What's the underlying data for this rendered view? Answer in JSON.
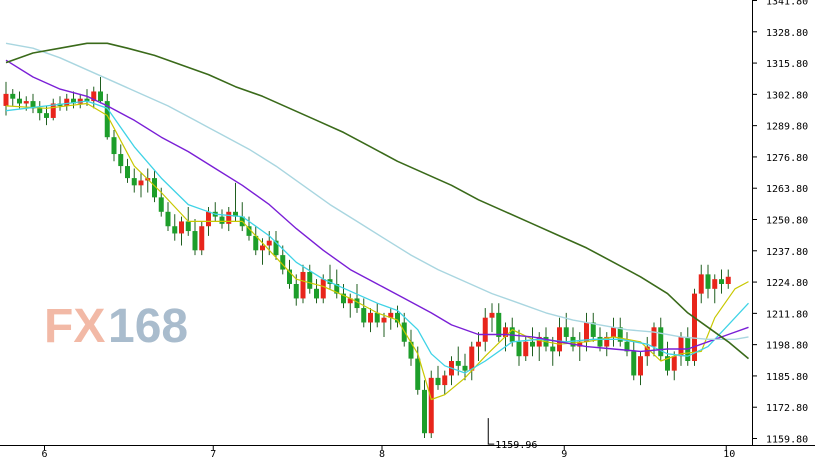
{
  "watermark": {
    "text_fx": "FX",
    "text_num": "168",
    "color_fx": "#f2b9a6",
    "color_num": "#a9bccd"
  },
  "colors": {
    "up": "#e8251b",
    "down": "#1d9e2a",
    "wick": "#1f5e1f",
    "ma_yellow": "#c8c800",
    "ma_cyan": "#3fd3e6",
    "ma_purple": "#7a1fd6",
    "ma_lightblue": "#a9d6e0",
    "ma_darkgreen": "#3a6a1a"
  },
  "chart_data": {
    "type": "candlestick",
    "title": "",
    "xlabel": "",
    "ylabel": "",
    "ylim": [
      1155.0,
      1345.0
    ],
    "y_ticks": [
      "1159.80",
      "1172.80",
      "1185.80",
      "1198.80",
      "1211.80",
      "1224.80",
      "1237.80",
      "1250.80",
      "1263.80",
      "1276.80",
      "1289.80",
      "1302.80",
      "1315.80",
      "1328.80",
      "1341.80"
    ],
    "x_ticks": [
      "6",
      "7",
      "8",
      "9",
      "10"
    ],
    "x_tick_index": [
      6,
      31,
      56,
      83,
      107
    ],
    "annotation": {
      "text": "1159.96",
      "index": 71,
      "value": 1159.96
    },
    "candles": [
      [
        1298,
        1308,
        1294,
        1303
      ],
      [
        1303,
        1305,
        1298,
        1301
      ],
      [
        1301,
        1304,
        1297,
        1299
      ],
      [
        1299,
        1302,
        1296,
        1300
      ],
      [
        1300,
        1303,
        1295,
        1297
      ],
      [
        1297,
        1300,
        1292,
        1295
      ],
      [
        1295,
        1298,
        1290,
        1293
      ],
      [
        1293,
        1301,
        1292,
        1299
      ],
      [
        1299,
        1302,
        1296,
        1298
      ],
      [
        1298,
        1303,
        1296,
        1301
      ],
      [
        1301,
        1304,
        1297,
        1299
      ],
      [
        1299,
        1303,
        1297,
        1301
      ],
      [
        1301,
        1305,
        1298,
        1300
      ],
      [
        1300,
        1306,
        1297,
        1304
      ],
      [
        1304,
        1310,
        1299,
        1300
      ],
      [
        1300,
        1303,
        1284,
        1285
      ],
      [
        1285,
        1288,
        1275,
        1278
      ],
      [
        1278,
        1282,
        1270,
        1273
      ],
      [
        1273,
        1276,
        1266,
        1268
      ],
      [
        1268,
        1272,
        1262,
        1265
      ],
      [
        1265,
        1270,
        1260,
        1267
      ],
      [
        1267,
        1272,
        1262,
        1268
      ],
      [
        1268,
        1271,
        1258,
        1260
      ],
      [
        1260,
        1264,
        1252,
        1254
      ],
      [
        1254,
        1258,
        1246,
        1248
      ],
      [
        1248,
        1253,
        1242,
        1245
      ],
      [
        1245,
        1252,
        1240,
        1250
      ],
      [
        1250,
        1256,
        1244,
        1246
      ],
      [
        1246,
        1251,
        1236,
        1238
      ],
      [
        1238,
        1250,
        1236,
        1248
      ],
      [
        1248,
        1256,
        1244,
        1254
      ],
      [
        1254,
        1258,
        1250,
        1252
      ],
      [
        1252,
        1255,
        1247,
        1249
      ],
      [
        1249,
        1256,
        1246,
        1254
      ],
      [
        1254,
        1266,
        1250,
        1252
      ],
      [
        1252,
        1258,
        1246,
        1248
      ],
      [
        1248,
        1252,
        1242,
        1244
      ],
      [
        1244,
        1248,
        1236,
        1238
      ],
      [
        1238,
        1243,
        1232,
        1240
      ],
      [
        1240,
        1246,
        1236,
        1242
      ],
      [
        1242,
        1246,
        1234,
        1236
      ],
      [
        1236,
        1240,
        1228,
        1230
      ],
      [
        1230,
        1234,
        1222,
        1224
      ],
      [
        1224,
        1228,
        1215,
        1218
      ],
      [
        1218,
        1232,
        1216,
        1229
      ],
      [
        1229,
        1232,
        1220,
        1222
      ],
      [
        1222,
        1226,
        1216,
        1218
      ],
      [
        1218,
        1228,
        1216,
        1226
      ],
      [
        1226,
        1232,
        1222,
        1224
      ],
      [
        1224,
        1230,
        1218,
        1220
      ],
      [
        1220,
        1224,
        1214,
        1216
      ],
      [
        1216,
        1220,
        1210,
        1218
      ],
      [
        1218,
        1224,
        1212,
        1214
      ],
      [
        1214,
        1218,
        1206,
        1208
      ],
      [
        1208,
        1214,
        1204,
        1212
      ],
      [
        1212,
        1216,
        1206,
        1208
      ],
      [
        1208,
        1212,
        1202,
        1210
      ],
      [
        1210,
        1214,
        1205,
        1212
      ],
      [
        1212,
        1215,
        1206,
        1208
      ],
      [
        1208,
        1212,
        1198,
        1200
      ],
      [
        1200,
        1205,
        1190,
        1193
      ],
      [
        1193,
        1198,
        1178,
        1180
      ],
      [
        1180,
        1184,
        1160,
        1162
      ],
      [
        1162,
        1188,
        1160,
        1185
      ],
      [
        1185,
        1190,
        1180,
        1182
      ],
      [
        1182,
        1188,
        1178,
        1186
      ],
      [
        1186,
        1194,
        1182,
        1192
      ],
      [
        1192,
        1198,
        1186,
        1190
      ],
      [
        1190,
        1195,
        1184,
        1188
      ],
      [
        1188,
        1200,
        1184,
        1198
      ],
      [
        1198,
        1204,
        1192,
        1200
      ],
      [
        1200,
        1214,
        1196,
        1210
      ],
      [
        1210,
        1216,
        1204,
        1212
      ],
      [
        1212,
        1216,
        1200,
        1202
      ],
      [
        1202,
        1208,
        1196,
        1206
      ],
      [
        1206,
        1210,
        1198,
        1200
      ],
      [
        1200,
        1205,
        1190,
        1194
      ],
      [
        1194,
        1202,
        1192,
        1200
      ],
      [
        1200,
        1206,
        1194,
        1198
      ],
      [
        1198,
        1204,
        1192,
        1202
      ],
      [
        1202,
        1206,
        1196,
        1198
      ],
      [
        1198,
        1202,
        1190,
        1196
      ],
      [
        1196,
        1210,
        1194,
        1206
      ],
      [
        1206,
        1212,
        1200,
        1202
      ],
      [
        1202,
        1206,
        1196,
        1198
      ],
      [
        1198,
        1204,
        1192,
        1200
      ],
      [
        1200,
        1212,
        1196,
        1208
      ],
      [
        1208,
        1212,
        1200,
        1202
      ],
      [
        1202,
        1206,
        1196,
        1198
      ],
      [
        1198,
        1204,
        1194,
        1202
      ],
      [
        1202,
        1210,
        1198,
        1206
      ],
      [
        1206,
        1210,
        1198,
        1200
      ],
      [
        1200,
        1204,
        1194,
        1196
      ],
      [
        1196,
        1200,
        1184,
        1186
      ],
      [
        1186,
        1196,
        1182,
        1194
      ],
      [
        1194,
        1202,
        1190,
        1198
      ],
      [
        1198,
        1208,
        1194,
        1206
      ],
      [
        1206,
        1210,
        1192,
        1194
      ],
      [
        1194,
        1200,
        1186,
        1188
      ],
      [
        1188,
        1196,
        1184,
        1194
      ],
      [
        1194,
        1204,
        1190,
        1202
      ],
      [
        1202,
        1206,
        1190,
        1192
      ],
      [
        1192,
        1222,
        1190,
        1220
      ],
      [
        1220,
        1232,
        1216,
        1228
      ],
      [
        1228,
        1232,
        1218,
        1222
      ],
      [
        1222,
        1228,
        1216,
        1226
      ],
      [
        1226,
        1230,
        1220,
        1224
      ],
      [
        1224,
        1230,
        1222,
        1227
      ]
    ],
    "series": [
      {
        "color_key": "ma_yellow",
        "width": 1.2,
        "values": [
          [
            0,
            1298
          ],
          [
            6,
            1297
          ],
          [
            12,
            1299
          ],
          [
            15,
            1294
          ],
          [
            19,
            1273
          ],
          [
            23,
            1262
          ],
          [
            27,
            1250
          ],
          [
            31,
            1250
          ],
          [
            35,
            1250
          ],
          [
            39,
            1238
          ],
          [
            43,
            1226
          ],
          [
            47,
            1223
          ],
          [
            51,
            1218
          ],
          [
            55,
            1212
          ],
          [
            58,
            1209
          ],
          [
            61,
            1195
          ],
          [
            63,
            1176
          ],
          [
            65,
            1178
          ],
          [
            68,
            1185
          ],
          [
            71,
            1194
          ],
          [
            75,
            1205
          ],
          [
            78,
            1201
          ],
          [
            82,
            1199
          ],
          [
            86,
            1200
          ],
          [
            90,
            1202
          ],
          [
            94,
            1200
          ],
          [
            97,
            1192
          ],
          [
            100,
            1195
          ],
          [
            103,
            1196
          ],
          [
            105,
            1210
          ],
          [
            108,
            1222
          ],
          [
            110,
            1225
          ]
        ]
      },
      {
        "color_key": "ma_cyan",
        "width": 1.3,
        "values": [
          [
            0,
            1296
          ],
          [
            6,
            1298
          ],
          [
            12,
            1300
          ],
          [
            15,
            1297
          ],
          [
            19,
            1281
          ],
          [
            23,
            1268
          ],
          [
            27,
            1257
          ],
          [
            31,
            1253
          ],
          [
            35,
            1252
          ],
          [
            39,
            1244
          ],
          [
            43,
            1233
          ],
          [
            47,
            1226
          ],
          [
            51,
            1221
          ],
          [
            55,
            1216
          ],
          [
            58,
            1213
          ],
          [
            61,
            1205
          ],
          [
            63,
            1195
          ],
          [
            65,
            1190
          ],
          [
            68,
            1187
          ],
          [
            71,
            1192
          ],
          [
            75,
            1200
          ],
          [
            79,
            1201
          ],
          [
            83,
            1200
          ],
          [
            87,
            1201
          ],
          [
            91,
            1201
          ],
          [
            95,
            1199
          ],
          [
            98,
            1195
          ],
          [
            101,
            1194
          ],
          [
            104,
            1198
          ],
          [
            107,
            1207
          ],
          [
            110,
            1216
          ]
        ]
      },
      {
        "color_key": "ma_purple",
        "width": 1.4,
        "values": [
          [
            0,
            1317
          ],
          [
            4,
            1310
          ],
          [
            8,
            1305
          ],
          [
            12,
            1302
          ],
          [
            15,
            1298
          ],
          [
            19,
            1292
          ],
          [
            23,
            1285
          ],
          [
            27,
            1279
          ],
          [
            31,
            1272
          ],
          [
            35,
            1265
          ],
          [
            39,
            1257
          ],
          [
            43,
            1247
          ],
          [
            47,
            1238
          ],
          [
            51,
            1230
          ],
          [
            55,
            1224
          ],
          [
            59,
            1218
          ],
          [
            63,
            1212
          ],
          [
            66,
            1207
          ],
          [
            70,
            1203
          ],
          [
            74,
            1203
          ],
          [
            78,
            1202
          ],
          [
            82,
            1200
          ],
          [
            86,
            1198
          ],
          [
            90,
            1197
          ],
          [
            94,
            1196
          ],
          [
            98,
            1197
          ],
          [
            101,
            1197
          ],
          [
            104,
            1200
          ],
          [
            107,
            1203
          ],
          [
            110,
            1206
          ]
        ]
      },
      {
        "color_key": "ma_lightblue",
        "width": 1.4,
        "values": [
          [
            0,
            1324
          ],
          [
            4,
            1322
          ],
          [
            8,
            1318
          ],
          [
            12,
            1313
          ],
          [
            16,
            1308
          ],
          [
            20,
            1303
          ],
          [
            24,
            1298
          ],
          [
            28,
            1292
          ],
          [
            32,
            1286
          ],
          [
            36,
            1280
          ],
          [
            40,
            1273
          ],
          [
            44,
            1265
          ],
          [
            48,
            1257
          ],
          [
            52,
            1250
          ],
          [
            56,
            1243
          ],
          [
            60,
            1236
          ],
          [
            64,
            1230
          ],
          [
            68,
            1225
          ],
          [
            72,
            1220
          ],
          [
            76,
            1216
          ],
          [
            80,
            1212
          ],
          [
            84,
            1209
          ],
          [
            88,
            1207
          ],
          [
            92,
            1205
          ],
          [
            96,
            1204
          ],
          [
            100,
            1202
          ],
          [
            104,
            1201
          ],
          [
            108,
            1201
          ],
          [
            110,
            1202
          ]
        ]
      },
      {
        "color_key": "ma_darkgreen",
        "width": 1.6,
        "values": [
          [
            0,
            1316
          ],
          [
            4,
            1320
          ],
          [
            8,
            1322
          ],
          [
            12,
            1324
          ],
          [
            15,
            1324
          ],
          [
            18,
            1322
          ],
          [
            22,
            1319
          ],
          [
            26,
            1315
          ],
          [
            30,
            1311
          ],
          [
            34,
            1306
          ],
          [
            38,
            1302
          ],
          [
            42,
            1297
          ],
          [
            46,
            1292
          ],
          [
            50,
            1287
          ],
          [
            54,
            1281
          ],
          [
            58,
            1275
          ],
          [
            62,
            1270
          ],
          [
            66,
            1265
          ],
          [
            70,
            1259
          ],
          [
            74,
            1254
          ],
          [
            78,
            1249
          ],
          [
            82,
            1244
          ],
          [
            86,
            1239
          ],
          [
            90,
            1233
          ],
          [
            94,
            1227
          ],
          [
            98,
            1220
          ],
          [
            101,
            1212
          ],
          [
            104,
            1206
          ],
          [
            107,
            1200
          ],
          [
            110,
            1193
          ]
        ]
      }
    ],
    "grid": false,
    "legend": "none"
  }
}
